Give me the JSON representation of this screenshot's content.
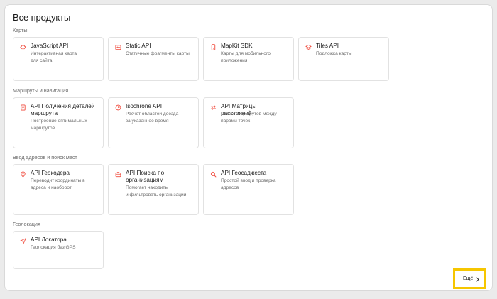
{
  "header": {
    "title": "Все продукты"
  },
  "sections": [
    {
      "title": "Карты",
      "cards": [
        {
          "title": "JavaScript API",
          "desc": "Интерактивная карта\nдля сайта",
          "icon": "code-icon"
        },
        {
          "title": "Static API",
          "desc": "Статичные фрагменты карты",
          "icon": "image-icon"
        },
        {
          "title": "MapKit SDK",
          "desc": "Карты для мобильного\nприложения",
          "icon": "phone-icon"
        },
        {
          "title": "Tiles API",
          "desc": "Подложка карты",
          "icon": "layers-icon"
        }
      ]
    },
    {
      "title": "Маршруты и навигация",
      "cards": [
        {
          "title": "API Получения деталей\nмаршрута",
          "desc": "Построение оптимальных\nмаршрутов",
          "icon": "route-doc-icon"
        },
        {
          "title": "Isochrone API",
          "desc": "Расчет областей доезда\nза указанное время",
          "icon": "clock-icon"
        },
        {
          "title": "API Матрицы расстояний",
          "desc": "Расчёт маршрутов между\nпарами точек",
          "icon": "arrows-icon"
        }
      ]
    },
    {
      "title": "Ввод адресов и поиск мест",
      "cards": [
        {
          "title": "API Геокодера",
          "desc": "Переводит координаты  в\nадреса и наоборот",
          "icon": "pin-icon"
        },
        {
          "title": "API Поиска по\nорганизациям",
          "desc": "Помогает находить\nи фильтровать организации",
          "icon": "briefcase-icon"
        },
        {
          "title": "API Геосаджеста",
          "desc": "Простой ввод и проверка\nадресов",
          "icon": "search-icon"
        }
      ]
    },
    {
      "title": "Геолокация",
      "cards": [
        {
          "title": "API Локатора",
          "desc": "Геолокация без GPS",
          "icon": "navigation-arrow-icon"
        }
      ]
    }
  ],
  "footer": {
    "more_label": "Ещё",
    "more_icon": "chevron-right-icon"
  },
  "colors": {
    "accent": "#f04a3c",
    "highlight": "#f6c600"
  }
}
